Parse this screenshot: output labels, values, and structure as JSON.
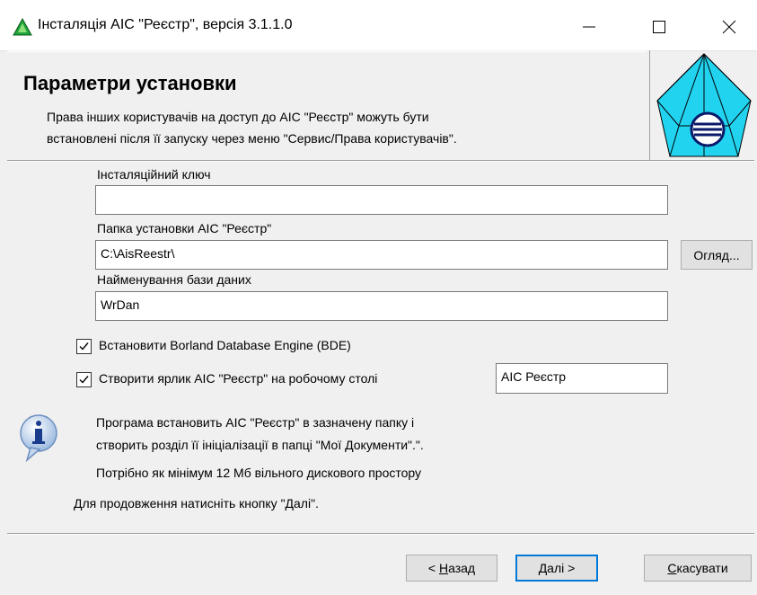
{
  "window": {
    "title": "Інсталяція АІС \"Реєстр\", версія 3.1.1.0"
  },
  "header": {
    "title": "Параметри установки",
    "description_line1": "Права інших користувачів на доступ до АІС \"Реєстр\" можуть бути",
    "description_line2": "встановлені після її запуску через меню \"Сервис/Права користувачів\"."
  },
  "fields": {
    "install_key_label": "Інсталяційний ключ",
    "install_key_value": "",
    "folder_label": "Папка установки АІС \"Реєстр\"",
    "folder_value": "C:\\AisReestr\\",
    "browse_label": "Огляд...",
    "db_label": "Найменування бази даних",
    "db_value": "WrDan"
  },
  "options": {
    "bde_label": "Встановити Borland Database Engine (BDE)",
    "bde_checked": true,
    "shortcut_label": "Створити ярлик АІС \"Реєстр\" на робочому столі",
    "shortcut_checked": true,
    "shortcut_name": "АІС Реєстр"
  },
  "info": {
    "line1": "Програма встановить АІС \"Реєстр\" в зазначену папку і",
    "line2": "створить розділ її ініціалізації в папці \"Мої Документи\".\".",
    "line3": "Потрібно як мінімум 12 Мб вільного дискового простору"
  },
  "continue_text": "Для продовження натисніть кнопку \"Далі\".",
  "buttons": {
    "back_prefix": "< ",
    "back_u": "Н",
    "back_rest": "азад",
    "next_u": "Д",
    "next_rest": "алі >",
    "cancel_u": "С",
    "cancel_rest": "касувати"
  }
}
